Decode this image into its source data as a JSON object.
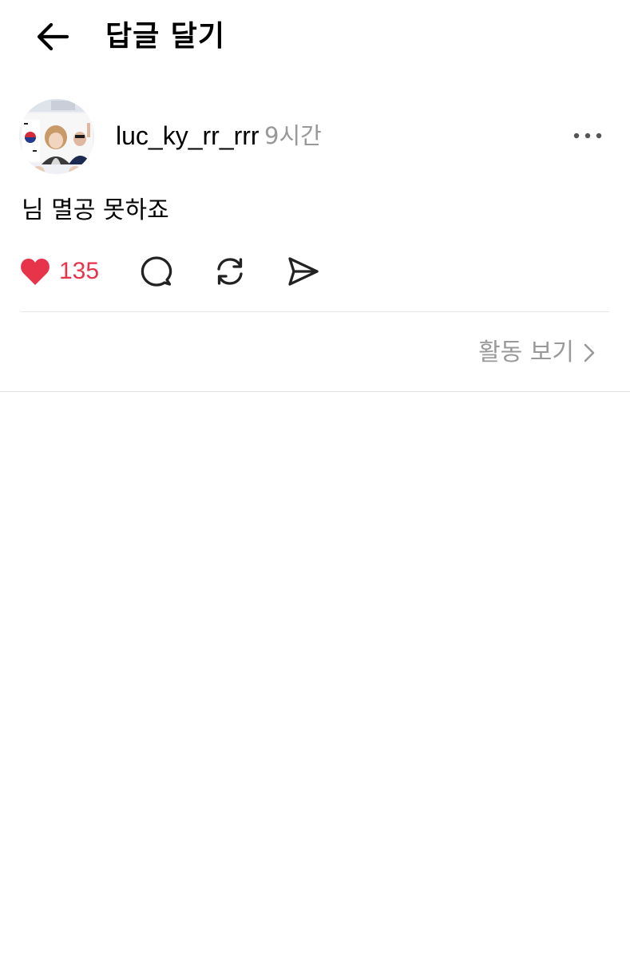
{
  "header": {
    "back_icon": "arrow-left-icon",
    "title": "답글 달기"
  },
  "post": {
    "username": "luc_ky_rr_rrr",
    "time": "9시간",
    "more_icon": "more-horizontal-icon",
    "text": "님 멸공 못하죠",
    "likes": "135",
    "liked": true,
    "icons": [
      "heart-icon",
      "comment-icon",
      "repost-icon",
      "share-icon"
    ]
  },
  "activity": {
    "label": "활동 보기",
    "icon": "chevron-right-icon"
  },
  "colors": {
    "like": "#e8344b",
    "muted": "#999999",
    "icon": "#222222",
    "divider": "#e6e6e6"
  }
}
